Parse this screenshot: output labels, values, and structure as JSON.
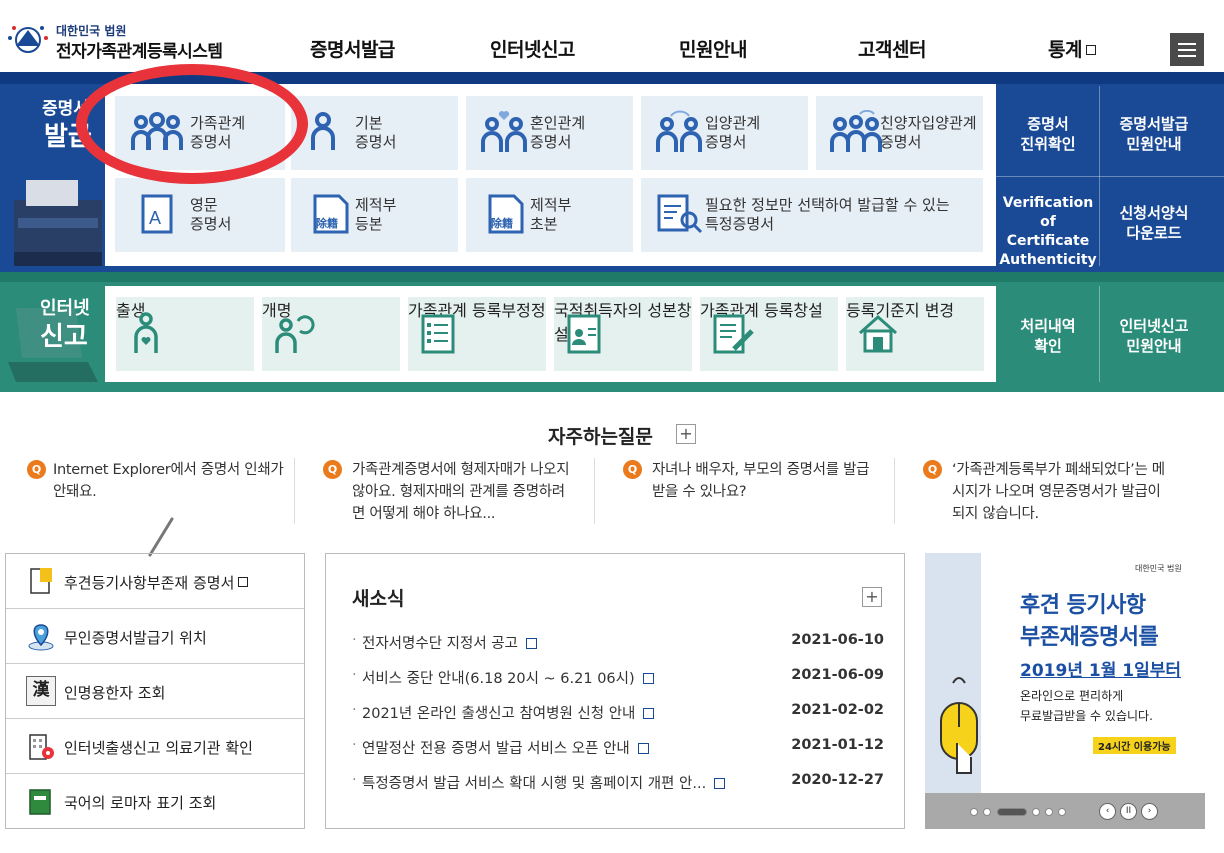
{
  "header": {
    "logo_sub": "대한민국 법원",
    "logo_main": "전자가족관계등록시스템",
    "nav": [
      "증명서발급",
      "인터넷신고",
      "민원안내",
      "고객센터",
      "통계"
    ]
  },
  "issue_band": {
    "title_line1": "증명서",
    "title_line2": "발급",
    "tiles": [
      {
        "label1": "가족관계",
        "label2": "증명서",
        "icon": "family-icon"
      },
      {
        "label1": "기본",
        "label2": "증명서",
        "icon": "person-icon"
      },
      {
        "label1": "혼인관계",
        "label2": "증명서",
        "icon": "couple-heart-icon"
      },
      {
        "label1": "입양관계",
        "label2": "증명서",
        "icon": "adoption-icon"
      },
      {
        "label1": "친양자입양관계",
        "label2": "증명서",
        "icon": "family-adoption-icon"
      },
      {
        "label1": "영문",
        "label2": "증명서",
        "icon": "english-doc-icon"
      },
      {
        "label1": "제적부",
        "label2": "등본",
        "icon": "removed-register-icon"
      },
      {
        "label1": "제적부",
        "label2": "초본",
        "icon": "removed-register-icon"
      },
      {
        "label1": "필요한 정보만 선택하여 발급할 수 있는",
        "label2": "특정증명서",
        "icon": "doc-search-icon"
      }
    ],
    "side_links": [
      {
        "line1": "증명서",
        "line2": "진위확인"
      },
      {
        "line1": "증명서발급",
        "line2": "민원안내"
      },
      {
        "line1": "Verification of",
        "line2": "Certificate",
        "line3": "Authenticity"
      },
      {
        "line1": "신청서양식",
        "line2": "다운로드"
      }
    ],
    "stamp_text": "除籍"
  },
  "report_band": {
    "title_line1": "인터넷",
    "title_line2": "신고",
    "tiles": [
      {
        "label1": "출생",
        "label2": ""
      },
      {
        "label1": "개명",
        "label2": ""
      },
      {
        "label1": "가족관계",
        "label2": "등록부정정"
      },
      {
        "label1": "국적취득자의",
        "label2": "성본창설"
      },
      {
        "label1": "가족관계",
        "label2": "등록창설"
      },
      {
        "label1": "등록기준지",
        "label2": "변경"
      }
    ],
    "side_links": [
      {
        "line1": "처리내역",
        "line2": "확인"
      },
      {
        "line1": "인터넷신고",
        "line2": "민원안내"
      }
    ]
  },
  "faq": {
    "title": "자주하는질문",
    "plus": "+",
    "badge": "Q",
    "items": [
      {
        "line1": "Internet Explorer에서 증명서 인쇄가",
        "line2": "안돼요.",
        "line3": ""
      },
      {
        "line1": "가족관계증명서에 형제자매가 나오지",
        "line2": "않아요. 형제자매의 관계를 증명하려",
        "line3": "면 어떻게 해야 하나요..."
      },
      {
        "line1": "자녀나 배우자, 부모의 증명서를 발급",
        "line2": "받을 수 있나요?",
        "line3": ""
      },
      {
        "line1": "‘가족관계등록부가 폐쇄되었다’는 메",
        "line2": "시지가 나오며 영문증명서가 발급이",
        "line3": "되지 않습니다."
      }
    ]
  },
  "quick_links": [
    {
      "label": "후견등기사항부존재 증명서"
    },
    {
      "label": "무인증명서발급기 위치"
    },
    {
      "label": "인명용한자 조회",
      "glyph": "漢"
    },
    {
      "label": "인터넷출생신고 의료기관 확인"
    },
    {
      "label": "국어의 로마자 표기 조회"
    }
  ],
  "news": {
    "title": "새소식",
    "plus": "+",
    "items": [
      {
        "title": "전자서명수단 지정서 공고",
        "date": "2021-06-10"
      },
      {
        "title": "서비스 중단 안내(6.18 20시 ~ 6.21 06시)",
        "date": "2021-06-09"
      },
      {
        "title": "2021년 온라인 출생신고 참여병원 신청 안내",
        "date": "2021-02-02"
      },
      {
        "title": "연말정산 전용 증명서 발급 서비스 오픈 안내",
        "date": "2021-01-12"
      },
      {
        "title": "특정증명서 발급 서비스 확대 시행 및 홈페이지 개편 안...",
        "date": "2020-12-27"
      }
    ]
  },
  "banner": {
    "court": "대한민국 법원",
    "line1": "후견 등기사항",
    "line2": "부존재증명서를",
    "line3": "2019년 1월 1일부터",
    "line4": "온라인으로 편리하게",
    "line5": "무료발급받을 수 있습니다.",
    "badge": "24시간 이용가능",
    "pause": "II",
    "prev": "‹",
    "next": "›"
  },
  "colors": {
    "issue_band": "#1a4a96",
    "report_band": "#2b8c7a",
    "tile_blue": "#e6eef6",
    "tile_green": "#e5f1ee",
    "icon_blue": "#2d63b0",
    "icon_green": "#2b8c7a",
    "faq_badge": "#ea7a1c",
    "annotation": "#e8333b"
  }
}
